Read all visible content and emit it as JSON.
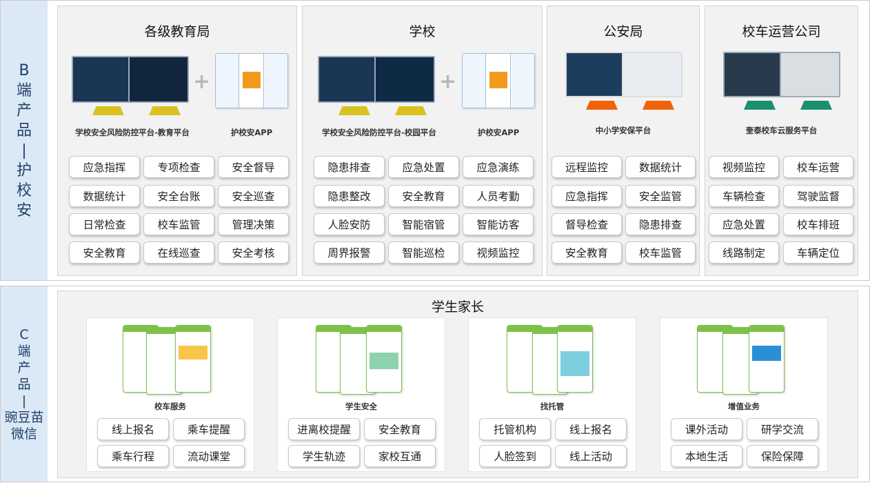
{
  "b_band": {
    "label": "B\n端\n产\n品\n|\n护\n校\n安",
    "panels": [
      {
        "title": "各级教育局",
        "products": [
          "学校安全风险防控平台-教育平台",
          "护校安APP"
        ],
        "buttons": [
          "应急指挥",
          "专项检查",
          "安全督导",
          "数据统计",
          "安全台账",
          "安全巡查",
          "日常检查",
          "校车监管",
          "管理决策",
          "安全教育",
          "在线巡查",
          "安全考核"
        ]
      },
      {
        "title": "学校",
        "products": [
          "学校安全风险防控平台-校园平台",
          "护校安APP"
        ],
        "buttons": [
          "隐患排查",
          "应急处置",
          "应急演练",
          "隐患整改",
          "安全教育",
          "人员考勤",
          "人脸安防",
          "智能宿管",
          "智能访客",
          "周界报警",
          "智能巡检",
          "视频监控"
        ]
      },
      {
        "title": "公安局",
        "products": [
          "中小学安保平台"
        ],
        "buttons": [
          "远程监控",
          "数据统计",
          "应急指挥",
          "安全监管",
          "督导检查",
          "隐患排查",
          "安全教育",
          "校车监管"
        ]
      },
      {
        "title": "校车运营公司",
        "products": [
          "奎泰校车云服务平台"
        ],
        "buttons": [
          "视频监控",
          "校车运营",
          "车辆检查",
          "驾驶监督",
          "应急处置",
          "校车排班",
          "线路制定",
          "车辆定位"
        ]
      }
    ]
  },
  "c_band": {
    "label": "C\n端\n产\n品\n|\n豌豆苗\n微信",
    "title": "学生家长",
    "cards": [
      {
        "title": "校车服务",
        "buttons": [
          "线上报名",
          "乘车提醒",
          "乘车行程",
          "流动课堂"
        ]
      },
      {
        "title": "学生安全",
        "buttons": [
          "进离校提醒",
          "安全教育",
          "学生轨迹",
          "家校互通"
        ]
      },
      {
        "title": "找托管",
        "buttons": [
          "托管机构",
          "线上报名",
          "人脸签到",
          "线上活动"
        ]
      },
      {
        "title": "增值业务",
        "buttons": [
          "课外活动",
          "研学交流",
          "本地生活",
          "保险保障"
        ]
      }
    ]
  },
  "colors": {
    "band_label_bg": "#dbe9f7",
    "stand_edu": "#d9c21f",
    "stand_school": "#d9c21f",
    "stand_police": "#f0620a",
    "stand_bus": "#1c8f6e",
    "phone_green": "#7dc14a"
  }
}
